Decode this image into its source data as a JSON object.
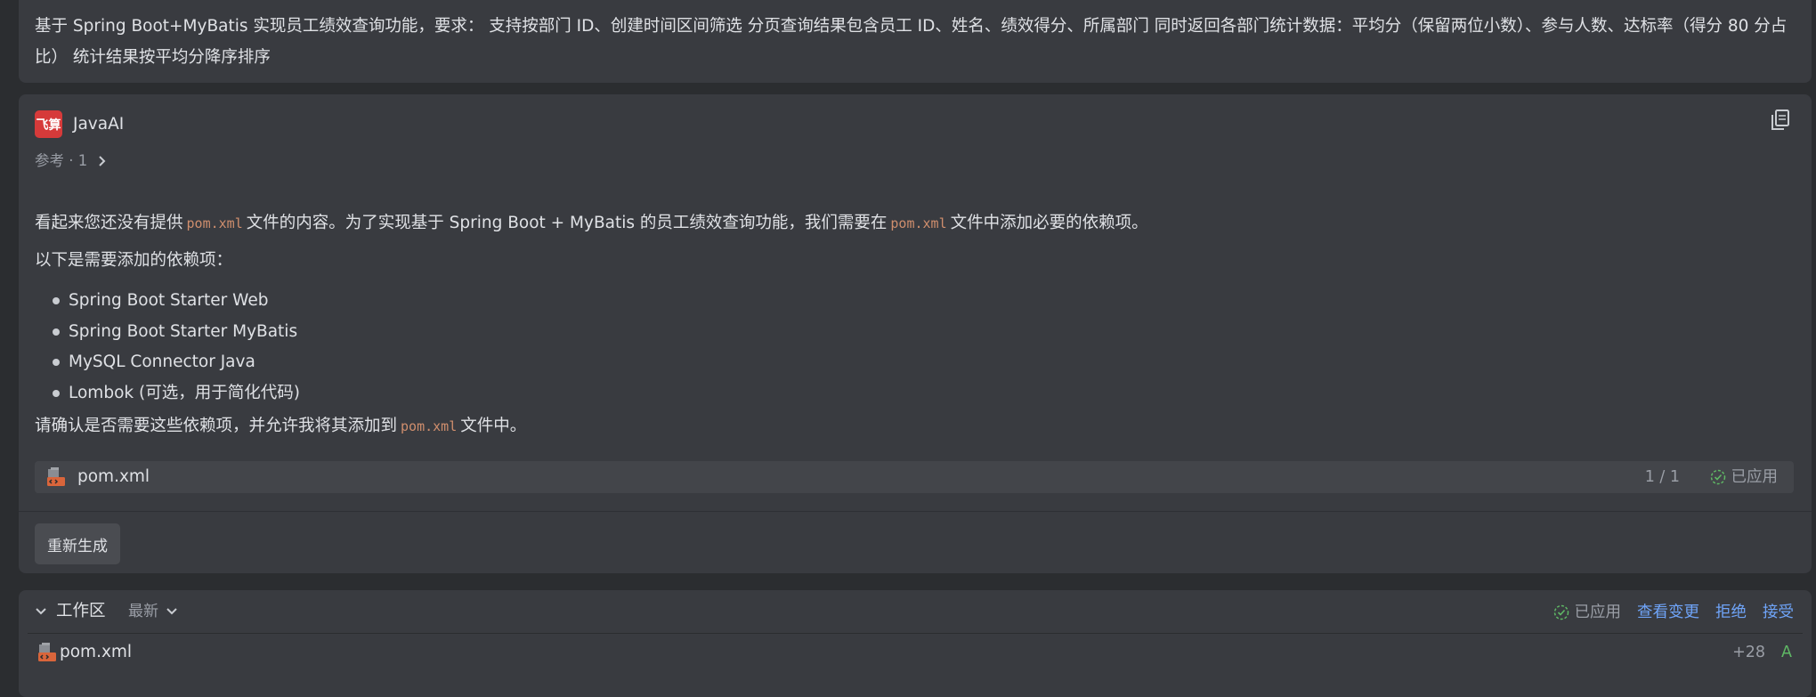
{
  "user_message": {
    "text": "基于 Spring Boot+MyBatis 实现员工绩效查询功能，要求： 支持按部门 ID、创建时间区间筛选 分页查询结果包含员工 ID、姓名、绩效得分、所属部门 同时返回各部门统计数据：平均分（保留两位小数）、参与人数、达标率（得分 80 分占比） 统计结果按平均分降序排序"
  },
  "ai": {
    "logo_text": "飞算",
    "name": "JavaAI",
    "refs_label": "参考 · 1",
    "para1": {
      "before": "看起来您还没有提供",
      "code": "pom.xml",
      "after": "文件的内容。为了实现基于 Spring Boot + MyBatis 的员工绩效查询功能，我们需要在",
      "code2": "pom.xml",
      "after2": "文件中添加必要的依赖项。"
    },
    "para2": "以下是需要添加的依赖项：",
    "dependencies": [
      "Spring Boot Starter Web",
      "Spring Boot Starter MyBatis",
      "MySQL Connector Java",
      "Lombok (可选，用于简化代码)"
    ],
    "para3": {
      "before": "请确认是否需要这些依赖项，并允许我将其添加到",
      "code": "pom.xml",
      "after": "文件中。"
    },
    "file": {
      "name": "pom.xml",
      "count": "1 / 1",
      "status": "已应用"
    },
    "regenerate_label": "重新生成"
  },
  "workspace": {
    "title": "工作区",
    "filter": "最新",
    "status": "已应用",
    "view_changes": "查看变更",
    "reject": "拒绝",
    "accept": "接受",
    "file": {
      "name": "pom.xml",
      "diff": "+28",
      "flag": "A"
    }
  },
  "colors": {
    "background": "#2b2d30",
    "panel": "#393b40",
    "link": "#6fa4f8",
    "applied_green": "#5fb865",
    "code": "#cf8e6d",
    "logo": "#d63a3a"
  }
}
